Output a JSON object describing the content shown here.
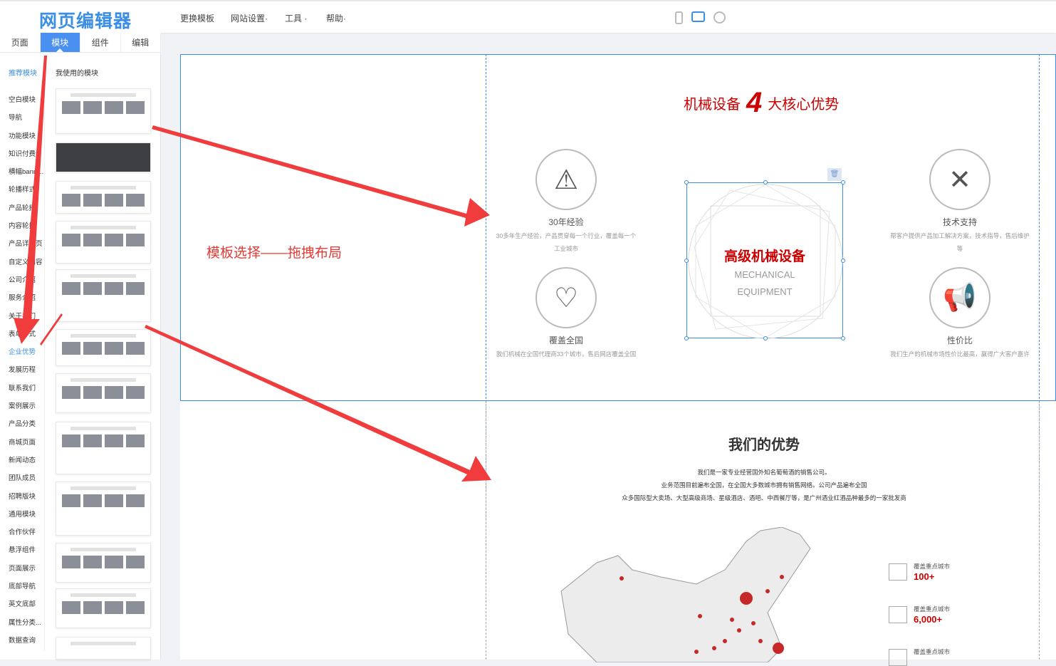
{
  "header": {
    "logo": "网页编辑器",
    "menu": [
      "更换模板",
      "网站设置·",
      "工具 ·",
      "帮助·"
    ]
  },
  "tabs": [
    "页面",
    "模块",
    "组件",
    "编辑"
  ],
  "subtabs": {
    "recommended": "推荐模块",
    "mine": "我使用的模块"
  },
  "categories": [
    "空白模块",
    "导航",
    "功能模块",
    "知识付费",
    "横幅banner...",
    "轮播样式",
    "产品轮播",
    "内容轮播",
    "产品详情页",
    "自定义内容",
    "公司介绍",
    "服务介绍",
    "关于我们",
    "表单样式",
    "企业优势",
    "发展历程",
    "联系我们",
    "案例展示",
    "产品分类",
    "商城页面",
    "新闻动态",
    "团队成员",
    "招聘版块",
    "通用模块",
    "合作伙伴",
    "悬浮组件",
    "页面展示",
    "底部导航",
    "英文底部",
    "属性分类...",
    "数据查询"
  ],
  "active_category": "企业优势",
  "annotation": "模板选择——拖拽布局",
  "section1": {
    "title_pre": "机械设备",
    "title_num": "4",
    "title_post": "大核心优势",
    "center_title": "高级机械设备",
    "center_en1": "MECHANICAL",
    "center_en2": "EQUIPMENT",
    "features": [
      {
        "title": "30年经验",
        "desc": "30多年生产经验，产品贯穿每一个行业，覆盖每一个工业城市"
      },
      {
        "title": "技术支持",
        "desc": "帮客户提供产品加工解决方案，技术指导，售后维护等"
      },
      {
        "title": "覆盖全国",
        "desc": "我们机械在全国代理商33个城市，售后网店覆盖全国"
      },
      {
        "title": "性价比",
        "desc": "我们生产的机械市场性价比最高，赢得广大客户嘉许"
      }
    ]
  },
  "section2": {
    "title": "我们的优势",
    "lines": [
      "我们是一家专业经营国外知名葡萄酒的销售公司。",
      "业务范围目前遍布全国，在全国大多数城市拥有销售网络。公司产品遍布全国",
      "众多国际型大卖场、大型高级商场、星级酒店、酒吧、中西餐厅等，是广州酒业红酒品种最多的一家批发商"
    ],
    "stats": [
      {
        "label": "覆盖重点城市",
        "value": "100+"
      },
      {
        "label": "覆盖重点城市",
        "value": "6,000+"
      },
      {
        "label": "覆盖重点城市",
        "value": ""
      }
    ]
  },
  "colors": {
    "accent": "#3a8ee6",
    "red": "#cc0000",
    "arrow": "#f03c3c"
  }
}
